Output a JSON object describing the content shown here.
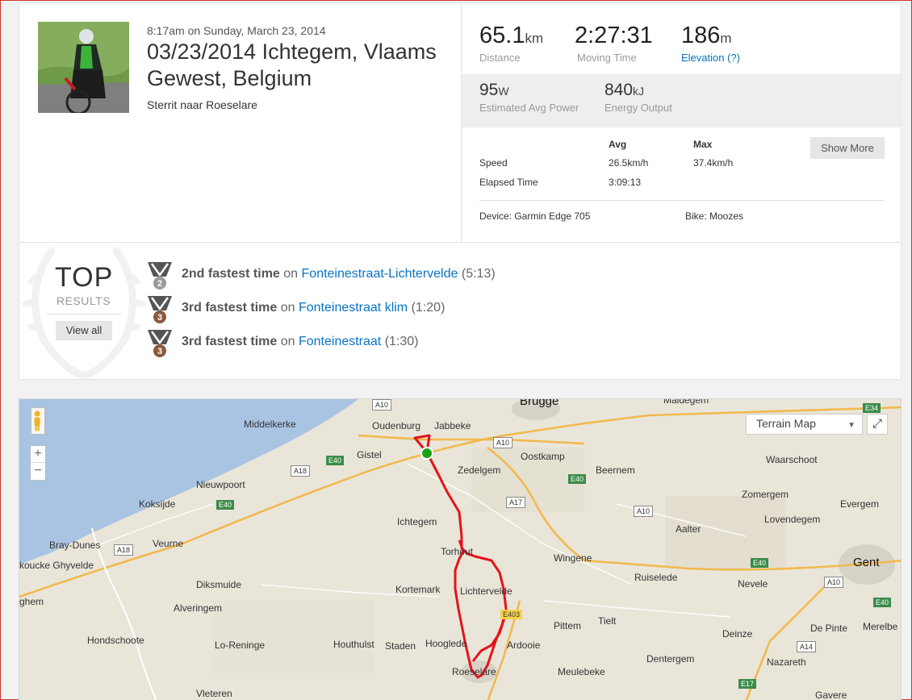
{
  "activity": {
    "date": "8:17am on Sunday, March 23, 2014",
    "title": "03/23/2014 Ichtegem, Vlaams Gewest, Belgium",
    "description": "Sterrit naar Roeselare"
  },
  "stats": {
    "distance": {
      "value": "65.1",
      "unit": "km",
      "label": "Distance"
    },
    "moving_time": {
      "value": "2:27:31",
      "label": "Moving Time"
    },
    "elevation": {
      "value": "186",
      "unit": "m",
      "label": "Elevation (?)"
    },
    "avg_power": {
      "value": "95",
      "unit": "W",
      "label": "Estimated Avg Power"
    },
    "energy": {
      "value": "840",
      "unit": "kJ",
      "label": "Energy Output"
    }
  },
  "details": {
    "col_avg": "Avg",
    "col_max": "Max",
    "show_more": "Show More",
    "rows": [
      {
        "label": "Speed",
        "avg": "26.5km/h",
        "max": "37.4km/h"
      },
      {
        "label": "Elapsed Time",
        "avg": "3:09:13",
        "max": ""
      }
    ],
    "device": "Device: Garmin Edge 705",
    "bike": "Bike: Moozes"
  },
  "top_results": {
    "title": "TOP",
    "subtitle": "RESULTS",
    "view_all": "View all",
    "items": [
      {
        "rank": "2nd fastest time",
        "on": "on",
        "segment": "Fonteinestraat-Lichtervelde",
        "time": "(5:13)",
        "medal_number": "2",
        "medal_color": "#9a9a9a"
      },
      {
        "rank": "3rd fastest time",
        "on": "on",
        "segment": "Fonteinestraat klim",
        "time": "(1:20)",
        "medal_number": "3",
        "medal_color": "#8a5a3a"
      },
      {
        "rank": "3rd fastest time",
        "on": "on",
        "segment": "Fonteinestraat",
        "time": "(1:30)",
        "medal_number": "3",
        "medal_color": "#8a5a3a"
      }
    ]
  },
  "map": {
    "map_type": "Terrain Map",
    "zoom_in": "+",
    "zoom_out": "−",
    "places": [
      "Brugge",
      "Maldegem",
      "Middelkerke",
      "Oudenburg",
      "Jabbeke",
      "Gistel",
      "Zedelgem",
      "Oostkamp",
      "Beernem",
      "Waarschoot",
      "Nieuwpoort",
      "Koksijde",
      "Ichtegem",
      "Zomergem",
      "Evergem",
      "Lovendegem",
      "Aalter",
      "Bray-Dunes",
      "Veurne",
      "Torhout",
      "Wingene",
      "Gent",
      "koucke Ghyvelde",
      "Diksmuide",
      "Kortemark",
      "Lichtervelde",
      "Ruiselede",
      "Nevele",
      "ghem",
      "Alveringem",
      "Pittem",
      "Tielt",
      "Deinze",
      "De Pinte",
      "Merelbe",
      "Hondschoote",
      "Lo-Reninge",
      "Houthulst",
      "Staden",
      "Hooglede",
      "Ardooie",
      "Meulebeke",
      "Dentergem",
      "Nazareth",
      "Roeselare",
      "Vleteren",
      "Gavere"
    ],
    "roads": [
      "A10",
      "E34",
      "A10",
      "E40",
      "A18",
      "E40",
      "A17",
      "E40",
      "A10",
      "E40",
      "A18",
      "A10",
      "E40",
      "A14",
      "E17",
      "E403"
    ],
    "route_color": "#e3141b",
    "start_color": "#1aa31a"
  },
  "colors": {
    "link": "#0a73c1",
    "accent_border": "#d0312d"
  }
}
